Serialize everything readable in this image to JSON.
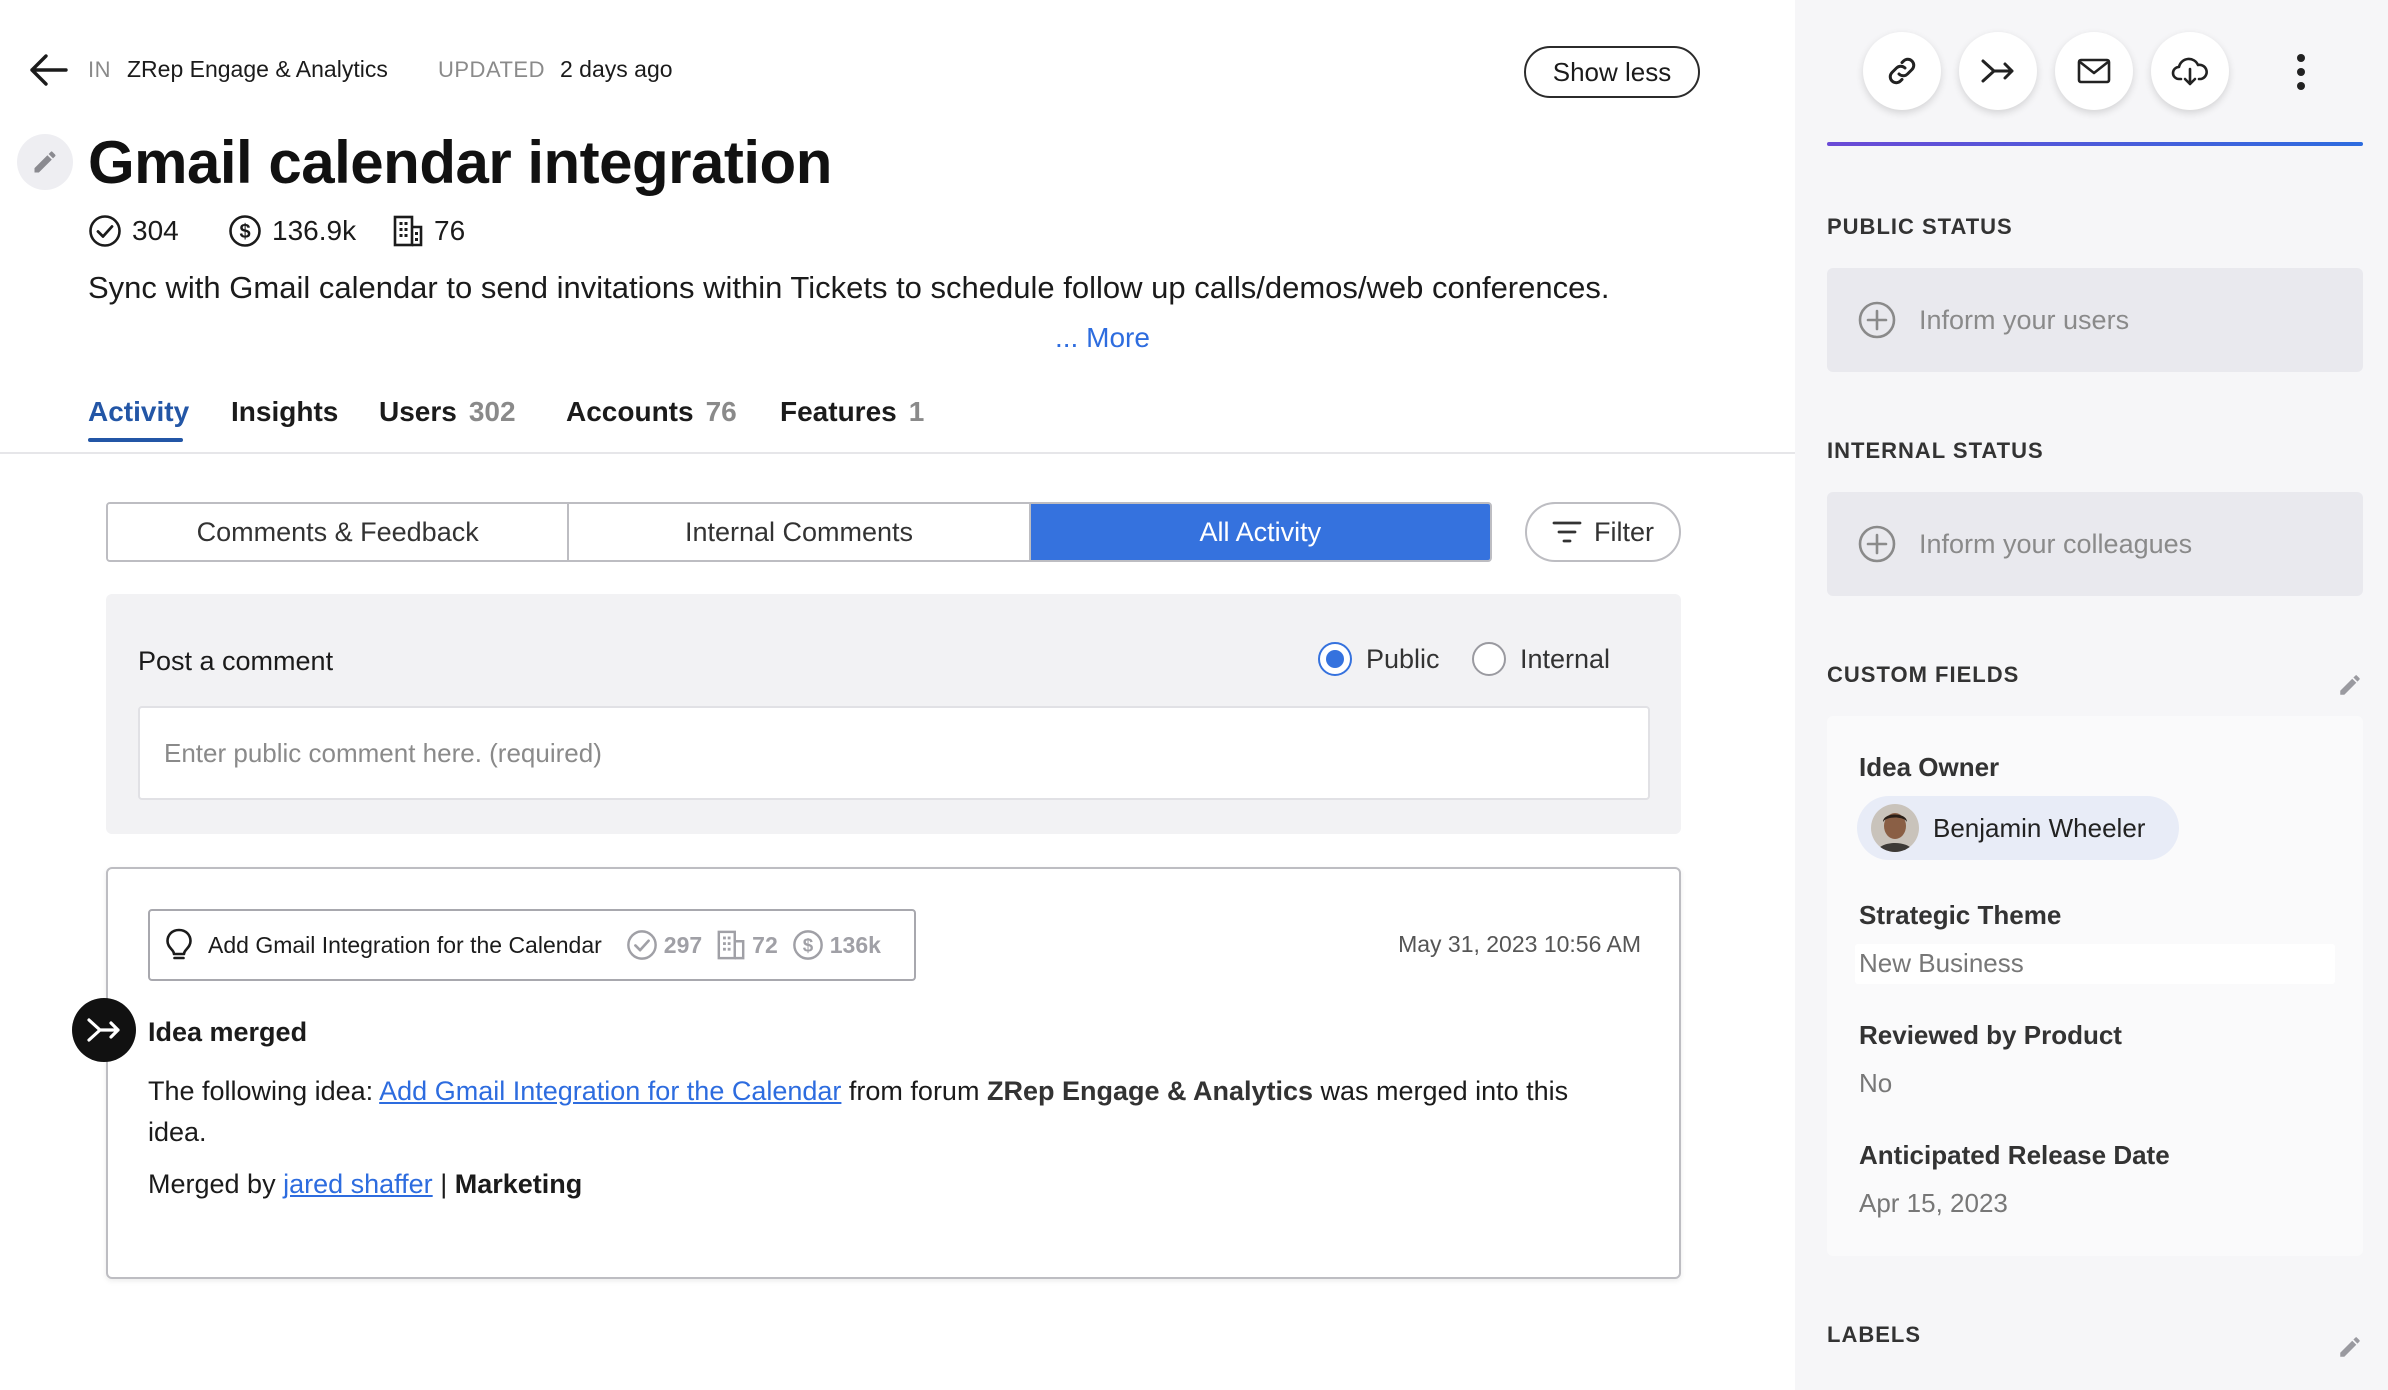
{
  "header": {
    "in_label": "IN",
    "forum_name": "ZRep Engage & Analytics",
    "updated_label": "UPDATED",
    "updated_value": "2 days ago",
    "show_less": "Show less"
  },
  "idea": {
    "title": "Gmail calendar integration",
    "stats": {
      "votes": "304",
      "value": "136.9k",
      "accounts": "76"
    },
    "description": "Sync with Gmail calendar to send invitations within Tickets to schedule follow up calls/demos/web conferences.",
    "more": "... More"
  },
  "tabs": [
    {
      "label": "Activity",
      "count": ""
    },
    {
      "label": "Insights",
      "count": ""
    },
    {
      "label": "Users",
      "count": "302"
    },
    {
      "label": "Accounts",
      "count": "76"
    },
    {
      "label": "Features",
      "count": "1"
    }
  ],
  "activity_filter": {
    "segments": [
      "Comments & Feedback",
      "Internal Comments",
      "All Activity"
    ],
    "selected": "All Activity",
    "filter_label": "Filter"
  },
  "comment": {
    "label": "Post a comment",
    "visibility_options": [
      "Public",
      "Internal"
    ],
    "visibility_selected": "Public",
    "placeholder": "Enter public comment here. (required)",
    "value": ""
  },
  "activity_item": {
    "chip_title": "Add Gmail Integration for the Calendar",
    "chip_votes": "297",
    "chip_accounts": "72",
    "chip_value": "136k",
    "date": "May 31, 2023 10:56 AM",
    "type": "Idea merged",
    "body_prefix": "The following idea: ",
    "body_link": "Add Gmail Integration for the Calendar",
    "body_mid": " from forum ",
    "body_forum": "ZRep Engage & Analytics",
    "body_suffix": "  was merged into this idea.",
    "merged_by_label": "Merged by ",
    "merged_by_user": "jared shaffer",
    "merged_by_sep": " | ",
    "merged_by_team": "Marketing"
  },
  "sidebar": {
    "public_status": {
      "label": "PUBLIC STATUS",
      "action": "Inform your users"
    },
    "internal_status": {
      "label": "INTERNAL STATUS",
      "action": "Inform your colleagues"
    },
    "custom_fields": {
      "label": "CUSTOM FIELDS",
      "fields": [
        {
          "label": "Idea Owner",
          "value": "Benjamin Wheeler"
        },
        {
          "label": "Strategic Theme",
          "value": "New Business"
        },
        {
          "label": "Reviewed by Product",
          "value": "No"
        },
        {
          "label": "Anticipated Release Date",
          "value": "Apr 15, 2023"
        }
      ]
    },
    "labels": {
      "label": "LABELS"
    }
  },
  "colors": {
    "accent_blue": "#3572de",
    "link_blue": "#2d6cdf",
    "tab_active": "#2356a6",
    "sidebar_bg": "#f6f6f8",
    "accent_gradient_start": "#6b4ad6"
  },
  "icons": [
    "back-arrow-icon",
    "pencil-icon",
    "check-circle-icon",
    "dollar-circle-icon",
    "building-icon",
    "filter-icon",
    "lightbulb-icon",
    "merge-icon",
    "link-icon",
    "mail-icon",
    "cloud-download-icon",
    "more-vertical-icon",
    "plus-circle-icon"
  ]
}
